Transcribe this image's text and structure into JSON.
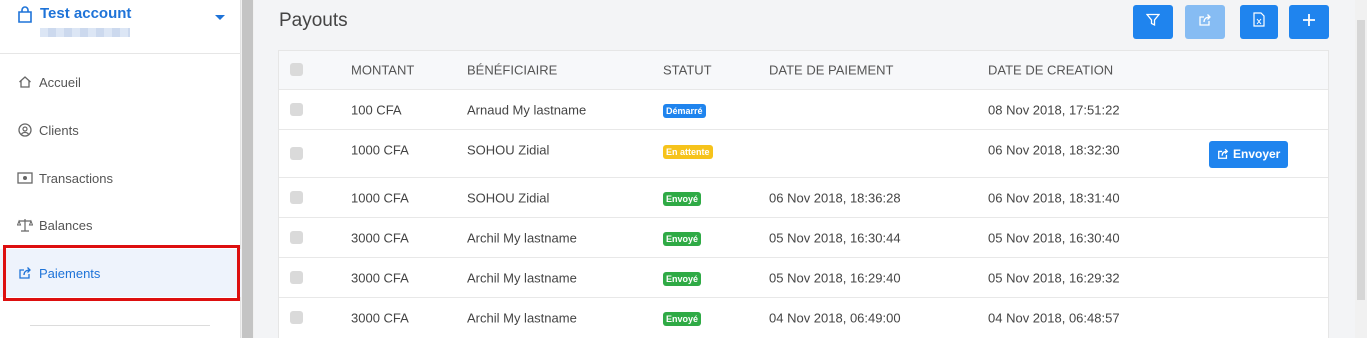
{
  "account": {
    "name": "Test account"
  },
  "nav": [
    {
      "label": "Accueil",
      "icon": "home-icon"
    },
    {
      "label": "Clients",
      "icon": "user-circle-icon"
    },
    {
      "label": "Transactions",
      "icon": "money-icon"
    },
    {
      "label": "Balances",
      "icon": "scale-icon"
    },
    {
      "label": "Paiements",
      "icon": "share-icon",
      "active": true
    }
  ],
  "page": {
    "title": "Payouts"
  },
  "toolbar": [
    {
      "name": "filter-button",
      "icon": "filter-icon"
    },
    {
      "name": "share-button",
      "icon": "share-icon"
    },
    {
      "name": "export-excel-button",
      "icon": "excel-file-icon"
    },
    {
      "name": "add-button",
      "icon": "plus-icon"
    }
  ],
  "table": {
    "headers": [
      "MONTANT",
      "BÉNÉFICIAIRE",
      "STATUT",
      "DATE DE PAIEMENT",
      "DATE DE CREATION"
    ],
    "rows": [
      {
        "amount": "100 CFA",
        "beneficiary": "Arnaud My lastname",
        "status": "Démarré",
        "status_color": "blue",
        "paid": "",
        "created": "08 Nov 2018, 17:51:22"
      },
      {
        "amount": "1000 CFA",
        "beneficiary": "SOHOU Zidial",
        "status": "En attente",
        "status_color": "yellow",
        "paid": "",
        "created": "06 Nov 2018, 18:32:30",
        "action": "Envoyer"
      },
      {
        "amount": "1000 CFA",
        "beneficiary": "SOHOU Zidial",
        "status": "Envoyé",
        "status_color": "green",
        "paid": "06 Nov 2018, 18:36:28",
        "created": "06 Nov 2018, 18:31:40"
      },
      {
        "amount": "3000 CFA",
        "beneficiary": "Archil My lastname",
        "status": "Envoyé",
        "status_color": "green",
        "paid": "05 Nov 2018, 16:30:44",
        "created": "05 Nov 2018, 16:30:40"
      },
      {
        "amount": "3000 CFA",
        "beneficiary": "Archil My lastname",
        "status": "Envoyé",
        "status_color": "green",
        "paid": "05 Nov 2018, 16:29:40",
        "created": "05 Nov 2018, 16:29:32"
      },
      {
        "amount": "3000 CFA",
        "beneficiary": "Archil My lastname",
        "status": "Envoyé",
        "status_color": "green",
        "paid": "04 Nov 2018, 06:49:00",
        "created": "04 Nov 2018, 06:48:57"
      }
    ]
  },
  "colors": {
    "accent": "#1f84ee",
    "highlight": "#dd0f0f"
  }
}
